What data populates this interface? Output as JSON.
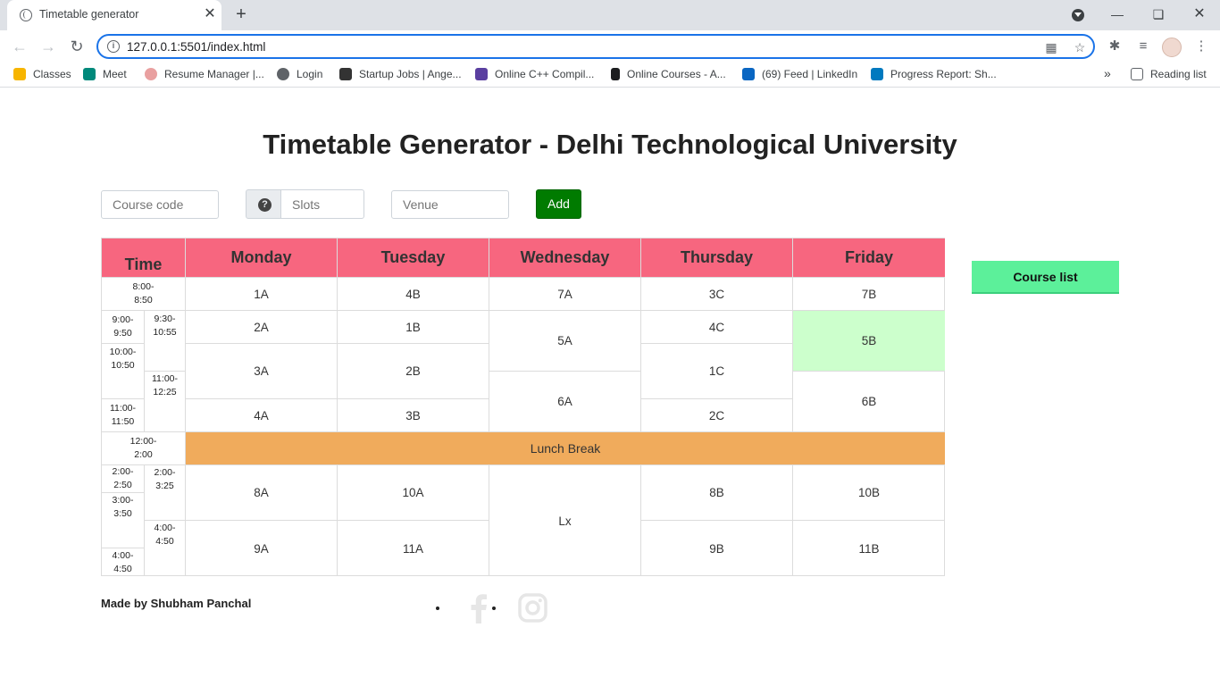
{
  "browser": {
    "tab_title": "Timetable generator",
    "url": "127.0.0.1:5501/index.html",
    "bookmarks": [
      {
        "label": "Classes",
        "icon": "google-classroom-icon",
        "color": "#f7b500"
      },
      {
        "label": "Meet",
        "icon": "google-meet-icon",
        "color": "#00897b"
      },
      {
        "label": "Resume Manager |...",
        "icon": "resume-manager-icon",
        "color": "#e9a0a0"
      },
      {
        "label": "Login",
        "icon": "globe-icon",
        "color": "#5f6368"
      },
      {
        "label": "Startup Jobs | Ange...",
        "icon": "angellist-icon",
        "color": "#333333"
      },
      {
        "label": "Online C++ Compil...",
        "icon": "bolt-icon",
        "color": "#5a3fa0"
      },
      {
        "label": "Online Courses - A...",
        "icon": "udemy-icon",
        "color": "#1c1d1f"
      },
      {
        "label": "(69) Feed | LinkedIn",
        "icon": "linkedin-icon",
        "color": "#0a66c2"
      },
      {
        "label": "Progress Report: Sh...",
        "icon": "trello-icon",
        "color": "#0079bf"
      }
    ],
    "more_bookmarks": "»",
    "reading_list": "Reading list"
  },
  "page": {
    "title": "Timetable Generator - Delhi Technological University",
    "form": {
      "course_code_placeholder": "Course code",
      "slots_placeholder": "Slots",
      "venue_placeholder": "Venue",
      "add_label": "Add",
      "help_glyph": "?"
    },
    "course_list_label": "Course list",
    "timetable": {
      "time_header": "Time",
      "days": [
        "Monday",
        "Tuesday",
        "Wednesday",
        "Thursday",
        "Friday"
      ],
      "times": {
        "t0800": "8:00-\n8:50",
        "t0900": "9:00-\n9:50",
        "t0930": "9:30-\n10:55",
        "t1000": "10:00-\n10:50",
        "t1100a": "11:00-\n12:25",
        "t1100b": "11:00-\n11:50",
        "t1200": "12:00-\n2:00",
        "t0200a": "2:00-\n2:50",
        "t0200b": "2:00-\n3:25",
        "t0300": "3:00-\n3:50",
        "t0400a": "4:00-\n4:50",
        "t0400b": "4:00-\n4:50"
      },
      "slots": {
        "mon": [
          "1A",
          "2A",
          "3A",
          "4A",
          "8A",
          "9A"
        ],
        "tue": [
          "4B",
          "1B",
          "2B",
          "3B",
          "10A",
          "11A"
        ],
        "wed": [
          "7A",
          "5A",
          "6A",
          "Lx"
        ],
        "thu": [
          "3C",
          "4C",
          "1C",
          "2C",
          "8B",
          "9B"
        ],
        "fri": [
          "7B",
          "5B",
          "6B",
          "10B",
          "11B"
        ]
      },
      "lunch": "Lunch Break",
      "highlight_color": "#ccffcc",
      "header_color": "#f7667f",
      "lunch_color": "#f0ab5c"
    },
    "footer": {
      "credit": "Made by Shubham Panchal",
      "social_icons": [
        "facebook-icon",
        "instagram-icon"
      ]
    }
  }
}
